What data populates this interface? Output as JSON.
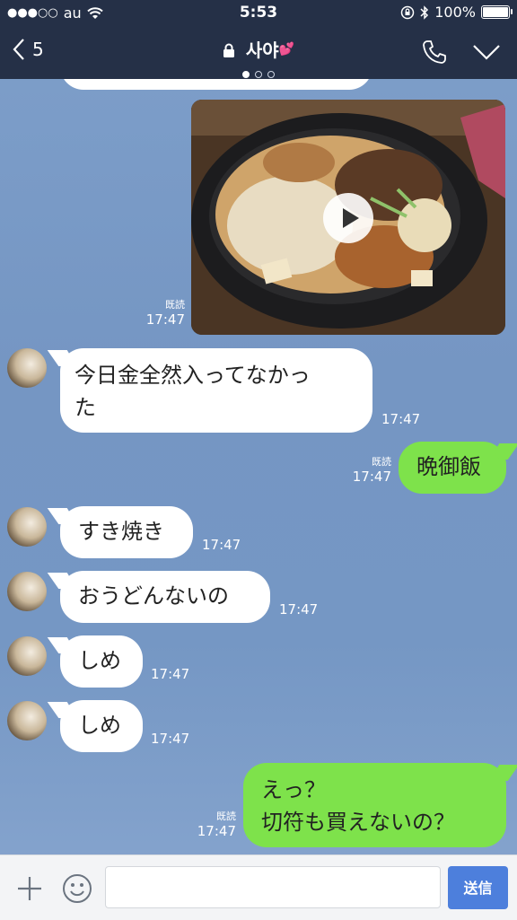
{
  "status": {
    "signal_dots": "●●●○○",
    "carrier": "au",
    "time": "5:53",
    "battery": "100%"
  },
  "nav": {
    "back_count": "5",
    "title": "사야",
    "title_emoji": "💕"
  },
  "messages": [
    {
      "side": "in",
      "lines": "今日金全然入ってなかっ\nた",
      "time": "17:47"
    },
    {
      "side": "out",
      "text": "晩御飯",
      "read": "既読",
      "time": "17:47"
    },
    {
      "side": "in",
      "text": "すき焼き",
      "time": "17:47"
    },
    {
      "side": "in",
      "text": "おうどんないの",
      "time": "17:47"
    },
    {
      "side": "in",
      "text": "しめ",
      "time": "17:47"
    },
    {
      "side": "in",
      "text": "しめ",
      "time": "17:47"
    },
    {
      "side": "out",
      "line1": "えっ？",
      "line2": "切符も買えないの？",
      "read": "既読",
      "time": "17:47"
    }
  ],
  "video_message": {
    "read": "既読",
    "time": "17:47"
  },
  "input": {
    "placeholder": "",
    "send_label": "送信"
  },
  "colors": {
    "nav_bg": "#253047",
    "outgoing_bubble": "#7ee24b",
    "send_button": "#4d7fdc"
  }
}
